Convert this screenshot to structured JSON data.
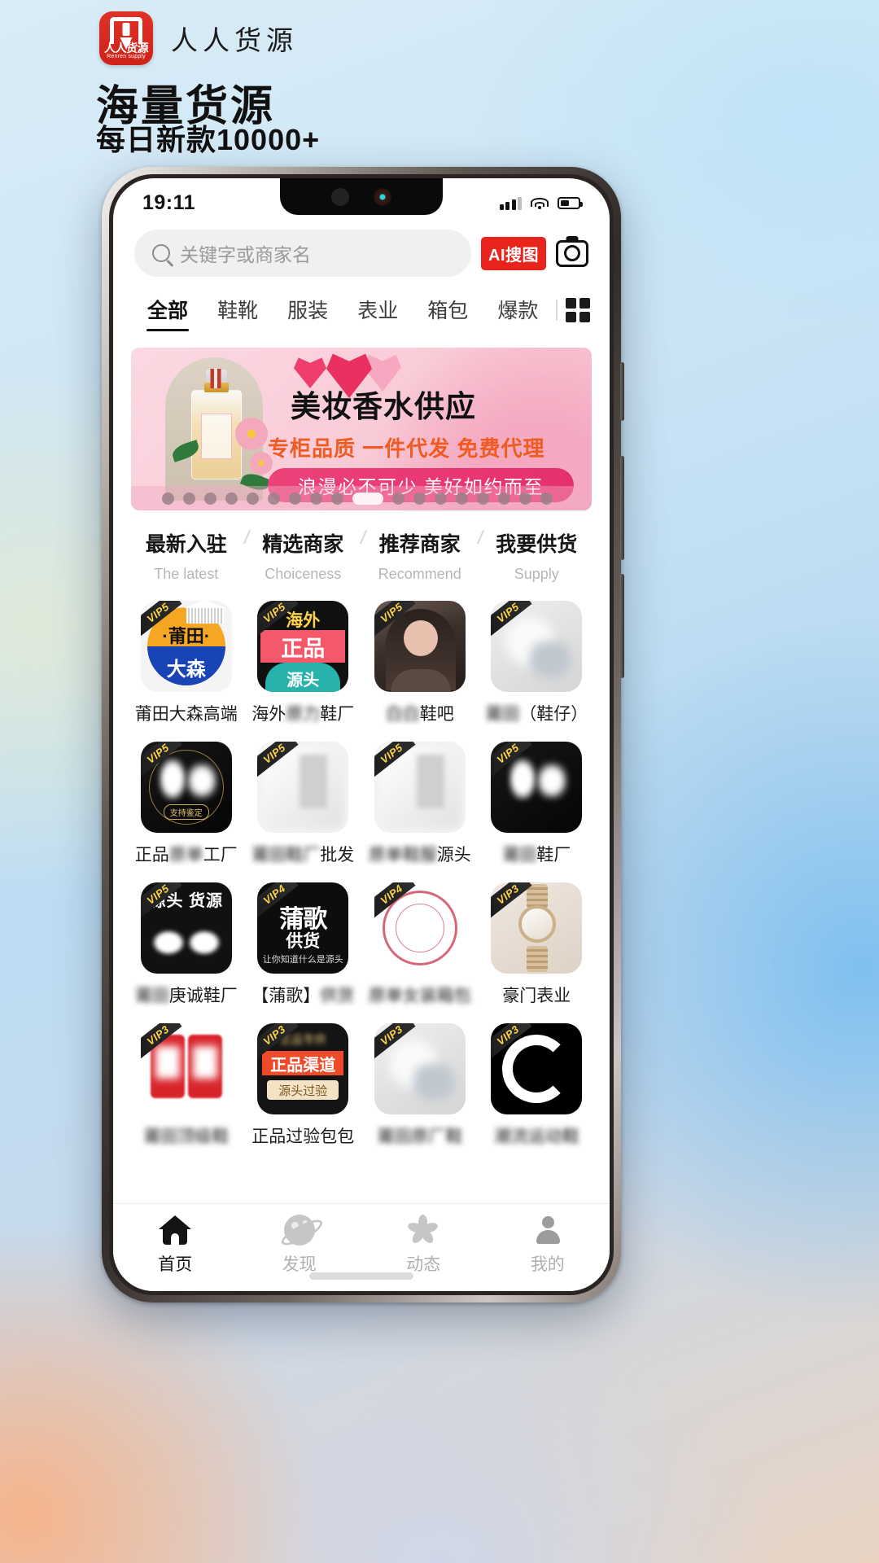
{
  "promo": {
    "brand_name": "人人货源",
    "logo_cn": "人人货源",
    "logo_en": "Renren supply",
    "headline": "海量货源",
    "subheadline": "每日新款10000+"
  },
  "status_bar": {
    "time": "19:11"
  },
  "search": {
    "placeholder": "关键字或商家名",
    "ai_button": "AI搜图",
    "camera_icon": "camera-icon",
    "search_icon": "search-icon"
  },
  "category_tabs": [
    {
      "label": "全部",
      "active": true
    },
    {
      "label": "鞋靴",
      "active": false
    },
    {
      "label": "服装",
      "active": false
    },
    {
      "label": "表业",
      "active": false
    },
    {
      "label": "箱包",
      "active": false
    },
    {
      "label": "爆款",
      "active": false
    }
  ],
  "grid_toggle_icon": "grid-view-icon",
  "banner": {
    "title": "美妆香水供应",
    "subtitle": "专柜品质 一件代发 免费代理",
    "pill": "浪漫必不可少 美好如约而至",
    "dots_total": 18,
    "active_dot": 10,
    "accent": "#ef5b20",
    "pill_color": "#e6306c"
  },
  "section_nav": [
    {
      "cn": "最新入驻",
      "en": "The latest"
    },
    {
      "cn": "精选商家",
      "en": "Choiceness"
    },
    {
      "cn": "推荐商家",
      "en": "Recommend"
    },
    {
      "cn": "我要供货",
      "en": "Supply"
    }
  ],
  "shops": [
    {
      "name": "莆田大森高端",
      "vip": "VIP5",
      "blur": "none",
      "thumb_cn1": "·莆田·",
      "thumb_cn2": "大森"
    },
    {
      "name": "海外原力鞋厂",
      "vip": "VIP5",
      "blur": "mid",
      "thumb_hw": "海外",
      "thumb_zp": "正品",
      "thumb_yt": "源头"
    },
    {
      "name": "白白鞋吧",
      "vip": "VIP5",
      "blur": "left"
    },
    {
      "name": "莆田（鞋仔）",
      "vip": "VIP5",
      "blur": "left"
    },
    {
      "name": "正品原单工厂",
      "vip": "VIP5",
      "blur": "mid",
      "thumb_tag": "支持鉴定"
    },
    {
      "name": "莆田鞋厂批发",
      "vip": "VIP5",
      "blur": "mid"
    },
    {
      "name": "原单鞋服源头",
      "vip": "VIP5",
      "blur": "mid"
    },
    {
      "name": "莆田鞋厂",
      "vip": "VIP5",
      "blur": "left"
    },
    {
      "name": "莆田庚诚鞋厂",
      "vip": "VIP5",
      "blur": "left",
      "thumb_top": "源头 货源"
    },
    {
      "name": "【蒲歌】供货",
      "vip": "VIP4",
      "blur": "right",
      "thumb_big": "蒲歌",
      "thumb_mid": "供货",
      "thumb_sm": "让你知道什么是源头"
    },
    {
      "name": "原单女装箱包",
      "vip": "VIP4",
      "blur": "full"
    },
    {
      "name": "豪门表业",
      "vip": "VIP3",
      "blur": "none"
    },
    {
      "name": "莆田顶级鞋",
      "vip": "VIP3",
      "blur": "full"
    },
    {
      "name": "正品过验包包",
      "vip": "VIP3",
      "blur": "right",
      "thumb_bar": "正品渠道",
      "thumb_bar2": "源头过验"
    },
    {
      "name": "莆田原厂鞋",
      "vip": "VIP3",
      "blur": "full"
    },
    {
      "name": "潮流运动鞋",
      "vip": "VIP3",
      "blur": "full"
    }
  ],
  "tabbar": [
    {
      "label": "首页",
      "icon": "home-icon",
      "active": true
    },
    {
      "label": "发现",
      "icon": "discover-planet-icon",
      "active": false
    },
    {
      "label": "动态",
      "icon": "activity-pinwheel-icon",
      "active": false
    },
    {
      "label": "我的",
      "icon": "profile-person-icon",
      "active": false
    }
  ]
}
